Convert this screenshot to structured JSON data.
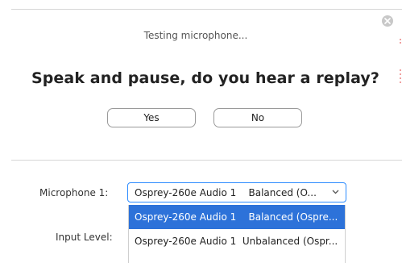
{
  "dialog": {
    "status_text": "Testing microphone...",
    "question": "Speak and pause, do you hear a replay?",
    "yes_label": "Yes",
    "no_label": "No"
  },
  "microphone": {
    "label": "Microphone 1:",
    "selected_value": "Osprey-260e Audio 1    Balanced (O...",
    "options": [
      {
        "label": "Osprey-260e Audio 1    Balanced (Ospre...",
        "selected": true
      },
      {
        "label": "Osprey-260e Audio 1  Unbalanced (Ospr...",
        "selected": false
      }
    ]
  },
  "input_level": {
    "label": "Input Level:"
  },
  "colors": {
    "accent": "#2d8cff",
    "selected_row": "#2d72d9",
    "close_button": "#c8c8c8"
  },
  "icons": [
    "close-icon",
    "chevron-down-icon"
  ]
}
